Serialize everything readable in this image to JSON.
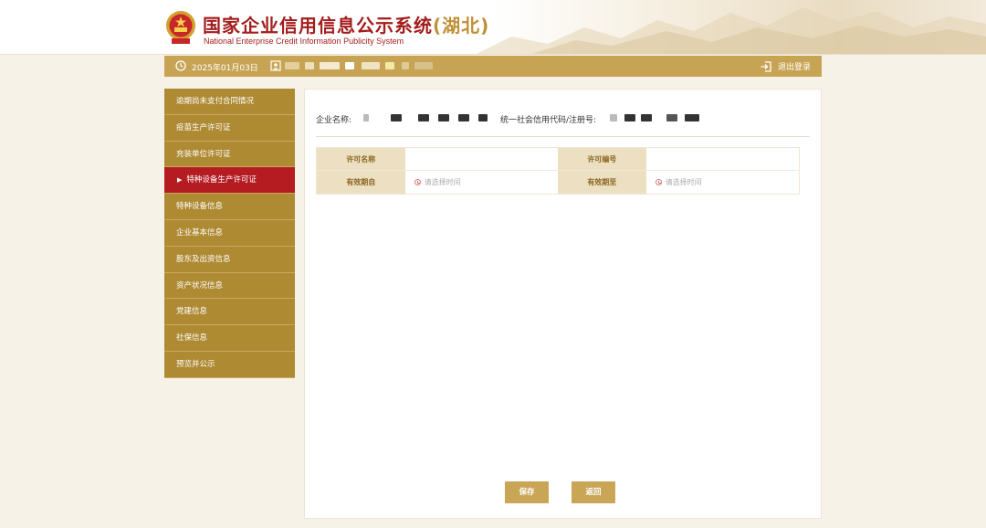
{
  "header": {
    "title_main": "国家企业信用信息公示系统",
    "title_region": "(湖北)",
    "subtitle": "National Enterprise Credit Information Publicity System"
  },
  "topbar": {
    "date": "2025年01月03日",
    "logout_label": "退出登录",
    "icons": {
      "date": "clock-icon",
      "user": "user-icon",
      "logout": "logout-icon"
    }
  },
  "sidebar": {
    "items": [
      {
        "label": "逾期尚未支付合同情况",
        "active": false
      },
      {
        "label": "疫苗生产许可证",
        "active": false
      },
      {
        "label": "充装单位许可证",
        "active": false
      },
      {
        "label": "特种设备生产许可证",
        "active": true
      },
      {
        "label": "特种设备信息",
        "active": false
      },
      {
        "label": "企业基本信息",
        "active": false
      },
      {
        "label": "股东及出资信息",
        "active": false
      },
      {
        "label": "资产状况信息",
        "active": false
      },
      {
        "label": "党建信息",
        "active": false
      },
      {
        "label": "社保信息",
        "active": false
      },
      {
        "label": "预览并公示",
        "active": false
      }
    ]
  },
  "main": {
    "company_name_label": "企业名称:",
    "credit_code_label": "统一社会信用代码/注册号:",
    "form": {
      "license_name_label": "许可名称",
      "license_name_value": "",
      "license_no_label": "许可编号",
      "license_no_value": "",
      "valid_from_label": "有效期自",
      "valid_from_placeholder": "请选择时间",
      "valid_to_label": "有效期至",
      "valid_to_placeholder": "请选择时间"
    },
    "save_label": "保存",
    "back_label": "返回"
  },
  "colors": {
    "gold": "#c7a454",
    "sidebar": "#ae8a33",
    "active": "#b51c22",
    "title_red": "#a41d1d"
  }
}
